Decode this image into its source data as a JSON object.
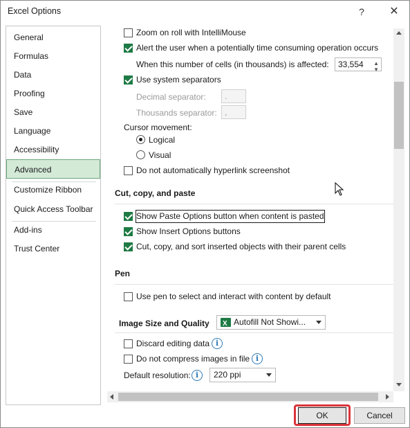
{
  "window": {
    "title": "Excel Options",
    "help": "?",
    "close": "✕"
  },
  "sidebar": {
    "items": [
      {
        "label": "General"
      },
      {
        "label": "Formulas"
      },
      {
        "label": "Data"
      },
      {
        "label": "Proofing"
      },
      {
        "label": "Save"
      },
      {
        "label": "Language"
      },
      {
        "label": "Accessibility"
      },
      {
        "label": "Advanced",
        "active": true
      },
      {
        "label": "Customize Ribbon"
      },
      {
        "label": "Quick Access Toolbar"
      },
      {
        "label": "Add-ins"
      },
      {
        "label": "Trust Center"
      }
    ]
  },
  "options": {
    "zoom_roll": {
      "label": "Zoom on roll with IntelliMouse",
      "checked": false
    },
    "alert_time": {
      "label": "Alert the user when a potentially time consuming operation occurs",
      "checked": true
    },
    "cells_affected": {
      "label": "When this number of cells (in thousands) is affected:",
      "value": "33,554"
    },
    "system_separators": {
      "label": "Use system separators",
      "checked": true
    },
    "decimal_sep": {
      "label": "Decimal separator:",
      "value": "."
    },
    "thousands_sep": {
      "label": "Thousands separator:",
      "value": ","
    },
    "cursor_movement": {
      "label": "Cursor movement:",
      "logical": "Logical",
      "visual": "Visual",
      "selected": "Logical"
    },
    "no_hyperlink": {
      "label": "Do not automatically hyperlink screenshot",
      "checked": false
    }
  },
  "cut_copy_paste": {
    "title": "Cut, copy, and paste",
    "show_paste": {
      "label": "Show Paste Options button when content is pasted",
      "checked": true
    },
    "show_insert": {
      "label": "Show Insert Options buttons",
      "checked": true
    },
    "cut_sort": {
      "label": "Cut, copy, and sort inserted objects with their parent cells",
      "checked": true
    }
  },
  "pen": {
    "title": "Pen",
    "use_pen": {
      "label": "Use pen to select and interact with content by default",
      "checked": false
    }
  },
  "image_quality": {
    "title": "Image Size and Quality",
    "workbook": "Autofill Not Showi...",
    "discard": {
      "label": "Discard editing data",
      "checked": false
    },
    "no_compress": {
      "label": "Do not compress images in file",
      "checked": false
    },
    "resolution": {
      "label": "Default resolution:",
      "value": "220 ppi"
    }
  },
  "icons": {
    "info": "i"
  },
  "footer": {
    "ok": "OK",
    "cancel": "Cancel"
  },
  "colors": {
    "accent_green": "#1e7a44",
    "highlight_red": "#d9353b",
    "active_nav": "#d3ead7"
  }
}
